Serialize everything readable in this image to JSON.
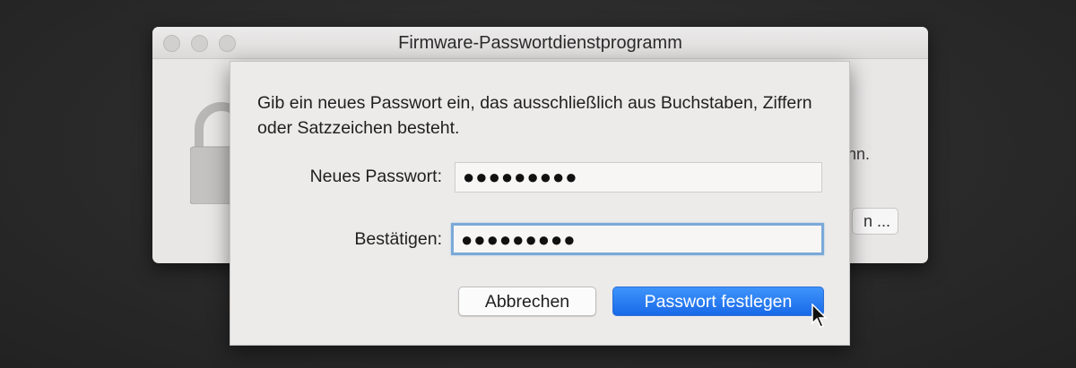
{
  "window": {
    "title": "Firmware-Passwortdienstprogramm",
    "partial_text": "ınn.",
    "partial_button": "n ..."
  },
  "sheet": {
    "message": "Gib ein neues Passwort ein, das ausschließlich aus Buchstaben, Ziffern oder Satzzeichen besteht.",
    "new_password_label": "Neues Passwort:",
    "new_password_value": "●●●●●●●●●",
    "confirm_label": "Bestätigen:",
    "confirm_value": "●●●●●●●●●",
    "cancel_label": "Abbrechen",
    "confirm_button_label": "Passwort festlegen"
  },
  "colors": {
    "accent": "#1969e8",
    "focus_ring": "#7ba9d8"
  },
  "icons": [
    "lock-icon",
    "cursor-icon"
  ]
}
